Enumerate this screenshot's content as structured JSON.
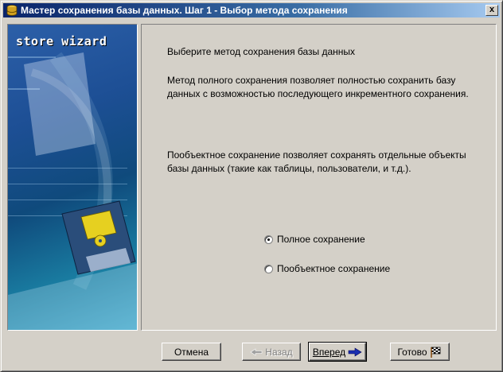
{
  "window": {
    "title": "Мастер сохранения базы данных. Шаг 1 - Выбор метода сохранения",
    "close_label": "x"
  },
  "banner": {
    "title": "store wizard"
  },
  "content": {
    "heading": "Выберите метод сохранения базы данных",
    "full_desc_line1": "Метод полного сохранения позволяет полностью сохранить базу",
    "full_desc_line2": "данных с возможностью последующего инкрементного сохранения.",
    "object_desc_line1": "Пообъектное сохранение позволяет сохранять отдельные объекты",
    "object_desc_line2": "базы данных (такие как таблицы, пользователи, и т.д.).",
    "options": [
      {
        "label": "Полное сохранение",
        "checked": true
      },
      {
        "label": "Пообъектное сохранение",
        "checked": false
      }
    ]
  },
  "buttons": {
    "cancel": "Отмена",
    "back": "Назад",
    "next": "Вперед",
    "finish": "Готово"
  },
  "colors": {
    "titlebar_start": "#0a246a",
    "face": "#d4d0c8"
  }
}
